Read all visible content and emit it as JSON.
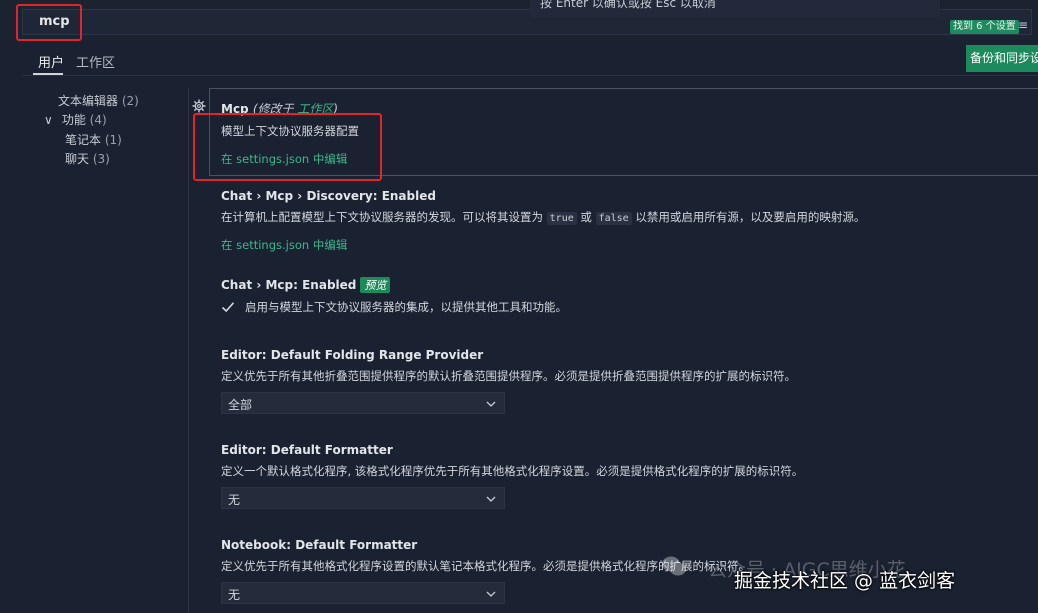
{
  "search": {
    "value": "mcp"
  },
  "hint_popup": {
    "text": "按 Enter 以确认或按 Esc 以取消"
  },
  "results": {
    "count_label": "找到 6 个设置",
    "filter_glyph": "≡"
  },
  "tabs": [
    {
      "label": "用户"
    },
    {
      "label": "工作区"
    }
  ],
  "sync_button": {
    "label": "备份和同步设置"
  },
  "toc": {
    "items": [
      {
        "label": "文本编辑器",
        "count": "(2)"
      },
      {
        "label": "功能",
        "count": "(4)",
        "chevron": "∨"
      },
      {
        "label": "笔记本",
        "count": "(1)"
      },
      {
        "label": "聊天",
        "count": "(3)"
      }
    ]
  },
  "settings": {
    "mcp": {
      "title": "Mcp",
      "modified_prefix": "(修改于 ",
      "modified_link": "工作区",
      "modified_suffix": ")",
      "description": "模型上下文协议服务器配置",
      "edit_link": "在 settings.json 中编辑"
    },
    "discovery": {
      "category": "Chat › Mcp › ",
      "title": "Discovery: Enabled",
      "desc_before": "在计算机上配置模型上下文协议服务器的发现。可以将其设置为 ",
      "code_true": "true",
      "desc_mid": " 或 ",
      "code_false": "false",
      "desc_after": " 以禁用或启用所有源，以及要启用的映射源。",
      "edit_link": "在 settings.json 中编辑"
    },
    "mcp_enabled": {
      "category": "Chat › Mcp: ",
      "title": "Enabled",
      "badge": "预览",
      "checkbox_label": "启用与模型上下文协议服务器的集成，以提供其他工具和功能。"
    },
    "folding": {
      "category": "Editor: ",
      "title": "Default Folding Range Provider",
      "description": "定义优先于所有其他折叠范围提供程序的默认折叠范围提供程序。必须是提供折叠范围提供程序的扩展的标识符。",
      "value": "全部"
    },
    "formatter": {
      "category": "Editor: ",
      "title": "Default Formatter",
      "description": "定义一个默认格式化程序, 该格式化程序优先于所有其他格式化程序设置。必须是提供格式化程序的扩展的标识符。",
      "value": "无"
    },
    "notebook_formatter": {
      "category": "Notebook: ",
      "title": "Default Formatter",
      "description": "定义优先于所有其他格式化程序设置的默认笔记本格式化程序。必须是提供格式化程序的扩展的标识符。",
      "value": "无"
    }
  },
  "watermark": {
    "faint": "公众号 · AIGC思维小花",
    "main": "掘金技术社区 @ 蓝衣剑客"
  },
  "colors": {
    "accent": "#1d8a5c",
    "link": "#3fb68b",
    "highlight": "#e0262a",
    "background": "#1a2130"
  }
}
